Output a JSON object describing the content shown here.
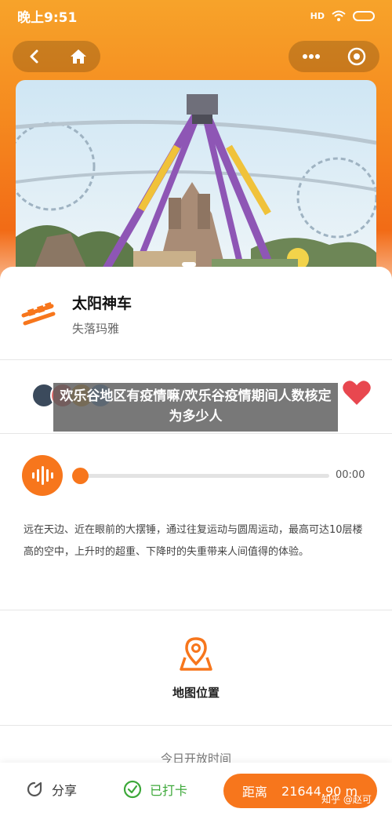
{
  "status_bar": {
    "time": "晚上9:51",
    "signal": "HD"
  },
  "ride": {
    "name": "太阳神车",
    "area": "失落玛雅"
  },
  "banner": {
    "title": "欢乐谷地区有疫情嘛/欢乐谷疫情期间人数核定为多少人"
  },
  "audio": {
    "duration": "00:00",
    "progress": 0
  },
  "description": "远在天边、近在眼前的大摆锤，通过往复运动与圆周运动，最高可达10层楼高的空中，上升时的超重、下降时的失重带来人间值得的体验。",
  "map": {
    "label": "地图位置"
  },
  "open_time": {
    "label": "今日开放时间"
  },
  "bottom": {
    "share_label": "分享",
    "checkin_label": "已打卡",
    "distance_label": "距离",
    "distance_value": "21644.90 m"
  },
  "watermark": "知乎 @赵可",
  "colors": {
    "accent": "#f7761c",
    "checked": "#3da83a",
    "favorite": "#e8474f"
  }
}
